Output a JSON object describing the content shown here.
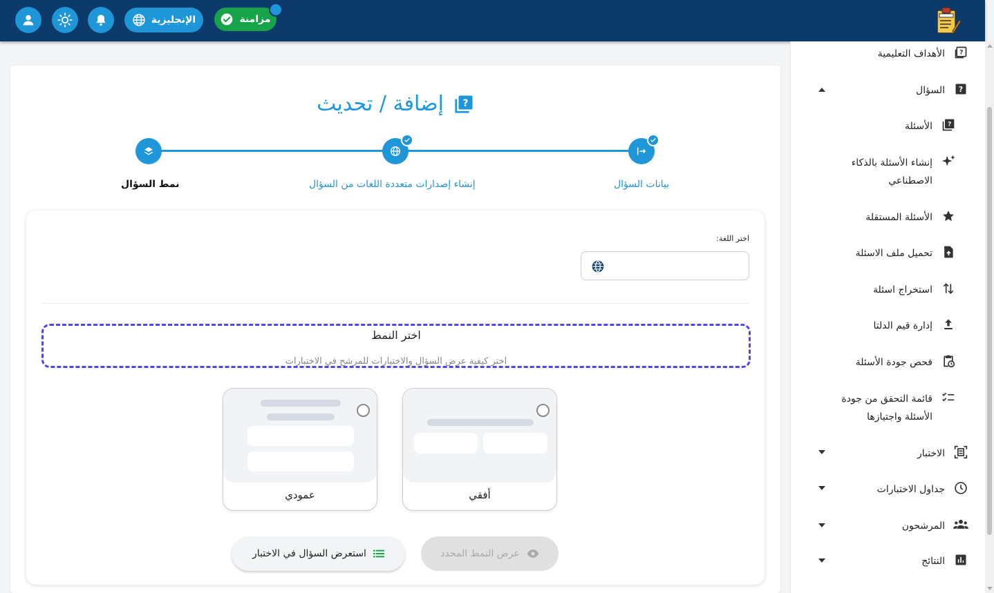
{
  "header": {
    "sync_label": "مزامنة",
    "language_label": "الإنجليزية",
    "icons": [
      "user-icon",
      "sun-icon",
      "bell-icon",
      "globe-icon",
      "check-circle-icon"
    ]
  },
  "sidebar": {
    "items": [
      {
        "label": "الأهداف التعليمية",
        "icon": "book-question-icon"
      },
      {
        "label": "السؤال",
        "icon": "question-box-icon",
        "expanded": true
      },
      {
        "label": "الأسئلة",
        "icon": "book-question-icon"
      },
      {
        "label": "إنشاء الأسئلة بالذكاء الاصطناعي",
        "icon": "sparkles-icon"
      },
      {
        "label": "الأسئلة المستقلة",
        "icon": "star-icon"
      },
      {
        "label": "تحميل ملف الاسئلة",
        "icon": "file-upload-icon"
      },
      {
        "label": "استخراج اسئلة",
        "icon": "swap-vertical-icon"
      },
      {
        "label": "إدارة قيم الدلتا",
        "icon": "upload-icon"
      },
      {
        "label": "فحص جودة الأسئلة",
        "icon": "clipboard-clock-icon"
      },
      {
        "label": "قائمة التحقق من جودة الأسئلة واجتيازها",
        "icon": "checklist-icon"
      },
      {
        "label": "الاختبار",
        "icon": "exam-frame-icon"
      },
      {
        "label": "جداول الاختبارات",
        "icon": "clock-icon"
      },
      {
        "label": "المرشحون",
        "icon": "people-icon"
      },
      {
        "label": "النتائج",
        "icon": "bar-chart-icon"
      }
    ]
  },
  "main": {
    "title": "إضافة / تحديث",
    "steps": [
      {
        "label": "بيانات السؤال",
        "completed": true
      },
      {
        "label": "إنشاء إصدارات متعددة اللغات من السؤال",
        "completed": true
      },
      {
        "label": "نمط السؤال",
        "completed": false,
        "active": true
      }
    ],
    "language_label": "اختر اللغة:",
    "pattern_title": "اختر النمط",
    "pattern_subtitle": "اختر كيفية عرض السؤال والاختيارات للمرشح في الاختبارات",
    "options": [
      {
        "label": "أفقي",
        "selected": false
      },
      {
        "label": "عمودي",
        "selected": false
      }
    ],
    "preview_button": "عرض النمط المحدد",
    "browse_button": "استعرض السؤال في الاختبار"
  },
  "colors": {
    "topbar": "#0b3a6b",
    "accent": "#1e96d8",
    "sync_green": "#16a34a",
    "dashed_border": "#4f46e5"
  }
}
